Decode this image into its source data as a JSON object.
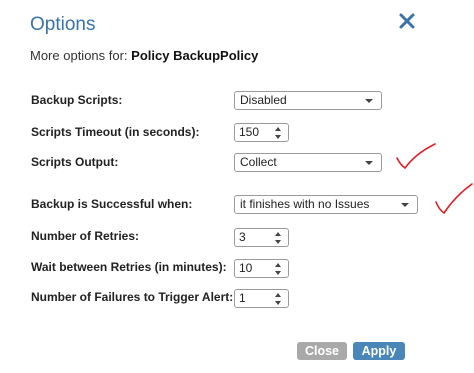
{
  "dialog": {
    "title": "Options",
    "subtitle_prefix": "More options for:",
    "policy_name": "Policy BackupPolicy"
  },
  "fields": {
    "backup_scripts": {
      "label": "Backup Scripts:",
      "value": "Disabled"
    },
    "scripts_timeout": {
      "label": "Scripts Timeout (in seconds):",
      "value": "150"
    },
    "scripts_output": {
      "label": "Scripts Output:",
      "value": "Collect"
    },
    "backup_successful": {
      "label": "Backup is Successful when:",
      "value": "it finishes with no Issues"
    },
    "number_of_retries": {
      "label": "Number of Retries:",
      "value": "3"
    },
    "wait_between_retries": {
      "label": "Wait between Retries (in minutes):",
      "value": "10"
    },
    "failures_to_alert": {
      "label": "Number of Failures to Trigger Alert:",
      "value": "1"
    }
  },
  "buttons": {
    "close_label": "Close",
    "apply_label": "Apply"
  },
  "colors": {
    "title": "#3a73a8",
    "apply": "#4a87b8",
    "close": "#a9a9a9",
    "annotation_check": "#e0202a"
  },
  "icons": {
    "close": "close-icon",
    "dropdown": "chevron-down-icon",
    "annotation": "checkmark-icon"
  }
}
